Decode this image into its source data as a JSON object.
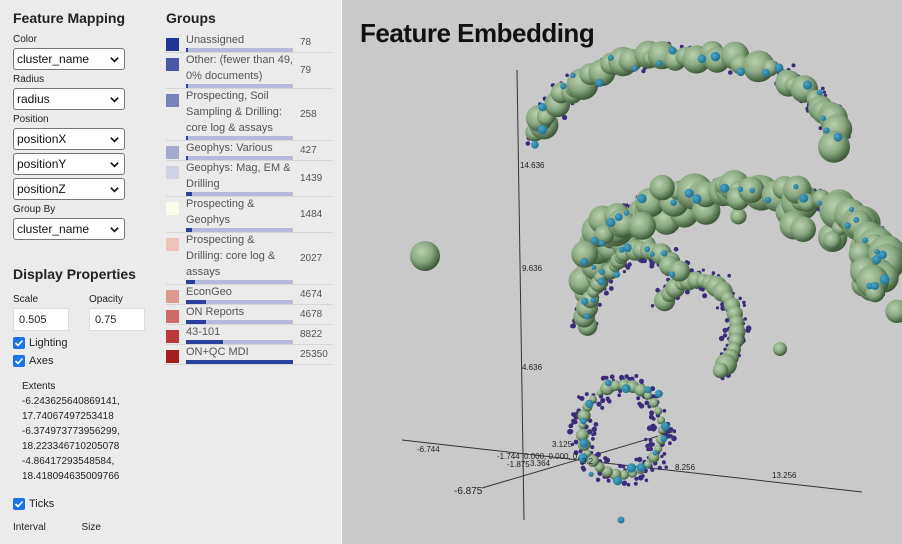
{
  "feature_mapping": {
    "title": "Feature Mapping",
    "color_label": "Color",
    "color_value": "cluster_name",
    "radius_label": "Radius",
    "radius_value": "radius",
    "position_label": "Position",
    "position_x": "positionX",
    "position_y": "positionY",
    "position_z": "positionZ",
    "group_by_label": "Group By",
    "group_by_value": "cluster_name"
  },
  "display_properties": {
    "title": "Display Properties",
    "scale_label": "Scale",
    "scale_value": "0.505",
    "opacity_label": "Opacity",
    "opacity_value": "0.75",
    "lighting_label": "Lighting",
    "lighting_checked": true,
    "axes_label": "Axes",
    "axes_checked": true,
    "extents_label": "Extents",
    "extents_lines": [
      "-6.243625640869141,",
      "17.74067497253418",
      "-6.374973773956299,",
      "18.223346710205078",
      "-4.86417293548584,",
      "18.418094635009766"
    ],
    "ticks_label": "Ticks",
    "ticks_checked": true,
    "interval_label": "Interval",
    "size_label": "Size"
  },
  "groups": {
    "title": "Groups",
    "items": [
      {
        "label": "Unassigned",
        "count": "78",
        "color": "#1f3794",
        "fill": 0.003
      },
      {
        "label": "Other: (fewer than 49, 0% documents)",
        "count": "79",
        "color": "#485aa6",
        "fill": 0.003
      },
      {
        "label": "Prospecting, Soil Sampling & Drilling: core log & assays",
        "count": "258",
        "color": "#7782b9",
        "fill": 0.01
      },
      {
        "label": "Geophys: Various",
        "count": "427",
        "color": "#a4abcf",
        "fill": 0.017
      },
      {
        "label": "Geophys: Mag, EM & Drilling",
        "count": "1439",
        "color": "#cfd3e1",
        "fill": 0.057
      },
      {
        "label": "Prospecting & Geophys",
        "count": "1484",
        "color": "#fbfbe9",
        "fill": 0.059
      },
      {
        "label": "Prospecting & Drilling: core log & assays",
        "count": "2027",
        "color": "#eec4ba",
        "fill": 0.08
      },
      {
        "label": "EconGeo",
        "count": "4674",
        "color": "#dc9a91",
        "fill": 0.185
      },
      {
        "label": "ON Reports",
        "count": "4678",
        "color": "#cd6b67",
        "fill": 0.185
      },
      {
        "label": "43-101",
        "count": "8822",
        "color": "#bb3a38",
        "fill": 0.348
      },
      {
        "label": "ON+QC MDI",
        "count": "25350",
        "color": "#a51e1f",
        "fill": 1.0
      }
    ]
  },
  "viewport": {
    "title": "Feature Embedding",
    "tick_labels": {
      "y_high": "14.636",
      "y_mid": "9.636",
      "y_low": "4.636",
      "x_neg": "-6.744",
      "x_near": "-1.744",
      "x_zero": "0.000, 0.000, 0.",
      "x_small": "3.125",
      "x_mid": "8.256",
      "x_far": "13.256",
      "z_neg": "-6.875",
      "z_near": "-1.875",
      "z_mid": "3.364",
      "z_small": "3.2"
    },
    "colors": {
      "sphere_green": "#8aa882",
      "sphere_dark": "#3f5a3b",
      "dot_blue": "#1f6e8c",
      "dot_purple": "#3a2e7a",
      "background": "#c9c9c9"
    }
  }
}
